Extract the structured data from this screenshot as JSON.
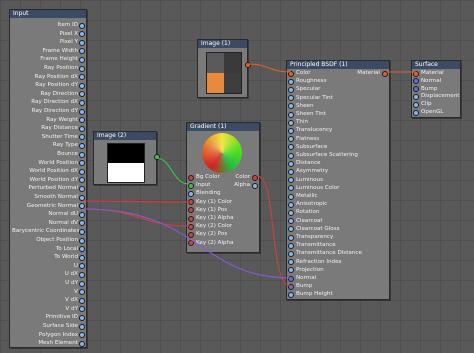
{
  "input_node": {
    "title": "Input",
    "rows": [
      "Item ID",
      "Pixel X",
      "Pixel Y",
      "Frame Width",
      "Frame Height",
      "Ray Position",
      "Ray Position dX",
      "Ray Position dY",
      "Ray Direction",
      "Ray Direction dX",
      "Ray Direction dY",
      "Ray Weight",
      "Ray Distance",
      "Shutter Time",
      "Ray Type",
      "Bounce",
      "World Position",
      "World Position dX",
      "World Position dY",
      "Perturbed Normal",
      "Smooth Normal",
      "Geometric Normal",
      "Normal dU",
      "Normal dV",
      "Barycentric Coordinates",
      "Object Position",
      "To Local",
      "To World",
      "U",
      "U dX",
      "U dY",
      "V",
      "V dX",
      "V dY",
      "Primitive ID",
      "Surface Side",
      "Polygon Index",
      "Mesh Element"
    ]
  },
  "image_node_1": {
    "title": "Image (1)"
  },
  "image_node_2": {
    "title": "Image (2)"
  },
  "gradient_node": {
    "title": "Gradient (1)",
    "inputs": [
      "Bg Color",
      "Input",
      "Blending",
      "Key (1) Color",
      "Key (1) Pos",
      "Key (1) Alpha",
      "Key (2) Color",
      "Key (2) Pos",
      "Key (2) Alpha"
    ],
    "outputs": [
      "Color",
      "Alpha"
    ]
  },
  "bsdf_node": {
    "title": "Principled BSDF (1)",
    "output": "Material",
    "inputs": [
      "Color",
      "Roughness",
      "Specular",
      "Specular Tint",
      "Sheen",
      "Sheen Tint",
      "Thin",
      "Translucency",
      "Flatness",
      "Subsurface",
      "Subsurface Scattering",
      "Distance",
      "Asymmetry",
      "Luminous",
      "Luminous Color",
      "Metallic",
      "Anisotropic",
      "Rotation",
      "Clearcoat",
      "Clearcoat Gloss",
      "Transparency",
      "Transmittance",
      "Transmittance Distance",
      "Refraction Index",
      "Projection",
      "Normal",
      "Bump",
      "Bump Height"
    ]
  },
  "surface_node": {
    "title": "Surface",
    "inputs": [
      "Material",
      "Normal",
      "Bump",
      "Displacement",
      "Clip",
      "OpenGL"
    ]
  },
  "colors": {
    "header": "#3a4b63",
    "node_body": "#7a7a7a",
    "wire_orange": "#e0602a",
    "wire_green": "#3cc04a",
    "wire_red": "#d04040",
    "wire_purple": "#8a5ad0",
    "wire_blue": "#5a70d8"
  }
}
